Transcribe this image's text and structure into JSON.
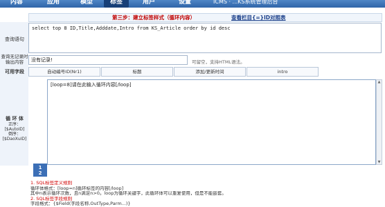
{
  "nav": {
    "tabs": [
      "内容",
      "应用",
      "模型",
      "标签",
      "用户",
      "设置"
    ],
    "notice": "ICMS · ...KS系统管理后台"
  },
  "step": {
    "title": "第三步：建立标签样式（循环内容）",
    "link": "查看栏目{=}ID对照表"
  },
  "query": {
    "label": "查询语句",
    "sql": "select top 8 ID,Title,Adddate,Intro from KS_Article order by id desc"
  },
  "no_record": {
    "label": "查询无记录时输出内容",
    "value": "没有记录!",
    "hint": "可留空，支持HTML语法。"
  },
  "fields": {
    "label": "可用字段",
    "buttons": [
      "自动编号ID(Nr1)",
      "标题",
      "添加/更新时间",
      "intro"
    ]
  },
  "loop": {
    "label": "循 环 体",
    "sub_label_1": "正序：",
    "sub_label_2": "[$AutoID]",
    "sub_label_3": "倒序：",
    "sub_label_4": "[$DaoXuID]",
    "content": "[loop=8]请在此输入循环内容[/loop]",
    "line_numbers": [
      "1",
      "2"
    ]
  },
  "rules": {
    "line1": "1. SQL标签定义规则",
    "line2": "循环体格式：[loop=n]循环标签的内容[/loop]",
    "line3": "其中n表示循环次数，且n满足n>0。loop为循环关键字，此循环体可以重复使用，但是不能嵌套。",
    "line4": "2. SQL标签字段规则",
    "line5": "字段格式：{$Field(字段名称,OutType,Parm...)}"
  }
}
